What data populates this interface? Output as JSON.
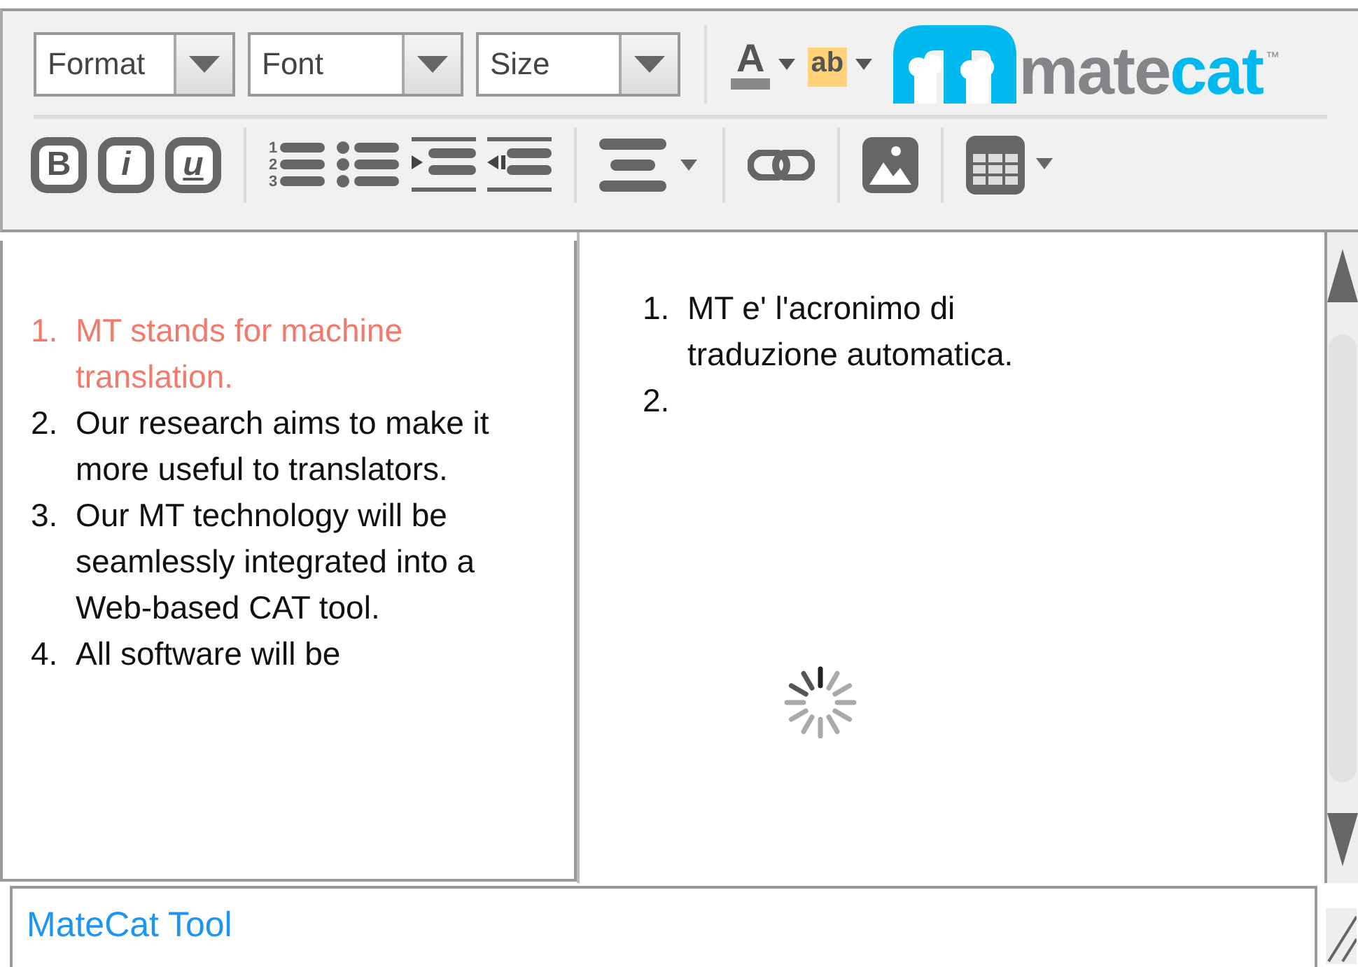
{
  "toolbar": {
    "dropdowns": [
      {
        "label": "Format"
      },
      {
        "label": "Font"
      },
      {
        "label": "Size"
      }
    ],
    "text_color_label": "A",
    "highlight_label": "ab",
    "style_buttons": [
      {
        "kind": "bold",
        "label": "B"
      },
      {
        "kind": "italic",
        "label": "i"
      },
      {
        "kind": "underline",
        "label": "u"
      }
    ],
    "ordered_list_digits": [
      "1",
      "2",
      "3"
    ]
  },
  "logo": {
    "parts": [
      "mate",
      "cat"
    ],
    "tm": "™"
  },
  "source": {
    "items": [
      {
        "number": "1.",
        "text": "MT stands for machine translation.",
        "selected": true
      },
      {
        "number": "2.",
        "text": "Our research aims to make it more useful to translators.",
        "selected": false
      },
      {
        "number": "3.",
        "text": "Our MT technology will be seamlessly integrated into a Web-based CAT tool.",
        "selected": false
      },
      {
        "number": "4.",
        "text": "All software will be",
        "selected": false
      }
    ]
  },
  "target": {
    "items": [
      {
        "number": "1.",
        "text": "MT e' l'acronimo di traduzione automatica."
      },
      {
        "number": "2."
      }
    ]
  },
  "footer": {
    "link": "MateCat Tool"
  }
}
